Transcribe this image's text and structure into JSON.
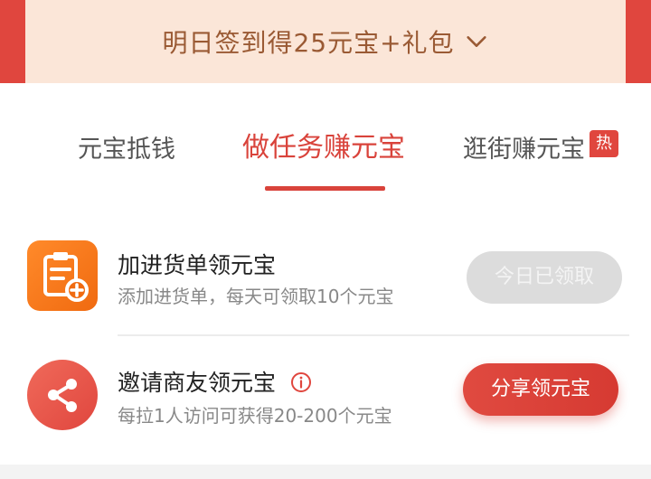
{
  "banner": {
    "text": "明日签到得25元宝+礼包"
  },
  "tabs": [
    {
      "label": "元宝抵钱"
    },
    {
      "label": "做任务赚元宝"
    },
    {
      "label": "逛街赚元宝"
    }
  ],
  "hot_badge": "热",
  "tasks": [
    {
      "title": "加进货单领元宝",
      "desc": "添加进货单，每天可领取10个元宝",
      "button": "今日已领取",
      "icon": "clipboard-add-icon"
    },
    {
      "title": "邀请商友领元宝",
      "desc": "每拉1人访问可获得20-200个元宝",
      "button": "分享领元宝",
      "icon": "share-icon"
    }
  ],
  "colors": {
    "accent": "#d9433b",
    "banner_bg": "#fbe6d8",
    "banner_text": "#9a5a34",
    "orange": "#f57a1c"
  }
}
